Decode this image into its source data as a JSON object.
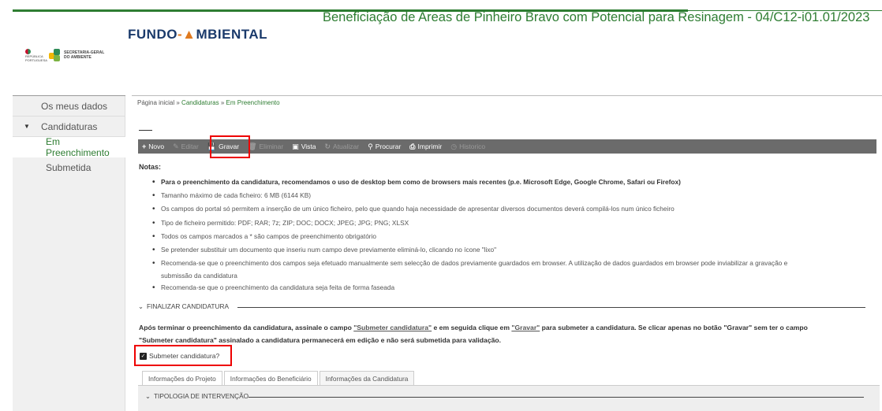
{
  "header": {
    "page_title": "Beneficiação de Areas de Pinheiro Bravo com Potencial para Resinagem - 04/C12-i01.01/2023",
    "fundo_logo": {
      "part1": "FUNDO",
      "part2": "MBIENTAL"
    },
    "rep_logo": "REPÚBLICA PORTUGUESA",
    "sg_logo": {
      "line1": "SECRETARIA-GERAL",
      "line2": "DO AMBIENTE"
    }
  },
  "sidebar": {
    "items": [
      {
        "label": "Os meus dados"
      },
      {
        "label": "Candidaturas",
        "expanded": true
      },
      {
        "label": "Em Preenchimento",
        "active": true
      },
      {
        "label": "Submetida"
      }
    ]
  },
  "breadcrumb": {
    "home": "Página inicial",
    "sep": " » ",
    "level1": "Candidaturas",
    "level2": "Em Preenchimento"
  },
  "toolbar": {
    "buttons": [
      {
        "label": "Novo",
        "icon": "plus-icon",
        "enabled": true
      },
      {
        "label": "Editar",
        "icon": "pencil-icon",
        "enabled": false
      },
      {
        "label": "Gravar",
        "icon": "save-icon",
        "enabled": true
      },
      {
        "label": "Eliminar",
        "icon": "trash-icon",
        "enabled": false
      },
      {
        "label": "Vista",
        "icon": "view-icon",
        "enabled": true
      },
      {
        "label": "Atualizar",
        "icon": "refresh-icon",
        "enabled": false
      },
      {
        "label": "Procurar",
        "icon": "search-icon",
        "enabled": true
      },
      {
        "label": "Imprimir",
        "icon": "print-icon",
        "enabled": true
      },
      {
        "label": "Historico",
        "icon": "history-icon",
        "enabled": false
      }
    ]
  },
  "notes": {
    "title": "Notas:",
    "items": [
      "Para o preenchimento da candidatura, recomendamos o uso de desktop bem como de browsers mais recentes (p.e. Microsoft Edge, Google Chrome, Safari ou Firefox)",
      "Tamanho máximo de cada ficheiro: 6 MB (6144 KB)",
      "Os campos do portal só permitem a inserção de um único ficheiro, pelo que quando haja necessidade de apresentar diversos documentos deverá compilá-los num único ficheiro",
      "Tipo de ficheiro permitido: PDF; RAR; 7z; ZIP; DOC; DOCX; JPEG; JPG; PNG; XLSX",
      "Todos os campos marcados a * são campos de preenchimento obrigatório",
      "Se pretender substituir um documento que inseriu num campo deve previamente eliminá-lo, clicando no ícone \"lixo\"",
      "Recomenda-se que o preenchimento dos campos seja efetuado manualmente sem selecção de dados previamente guardados em browser. A utilização de dados guardados em browser pode inviabilizar a gravação e",
      "submissão da candidatura",
      "Recomenda-se que o preenchimento da candidatura seja feita de forma faseada"
    ]
  },
  "finalizar": {
    "legend": "FINALIZAR CANDIDATURA",
    "text1": "Após terminar o preenchimento da candidatura, assinale o campo ",
    "link1": "\"Submeter candidatura\"",
    "text2": " e em seguida clique em ",
    "link2": "\"Gravar\"",
    "text3": " para submeter a candidatura. Se clicar apenas no botão \"Gravar\" sem ter o campo",
    "text4": "\"Submeter candidatura\" assinalado a candidatura permanecerá em edição e não será submetida para validação.",
    "checkbox_label": "Submeter candidatura?",
    "checkbox_checked": true
  },
  "tabs": [
    {
      "label": "Informações do Projeto"
    },
    {
      "label": "Informações do Beneficiário"
    },
    {
      "label": "Informações da Candidatura",
      "active": true
    }
  ],
  "tipologia": {
    "legend": "TIPOLOGIA DE INTERVENÇÃO"
  },
  "colors": {
    "brand_green": "#2e7d32",
    "toolbar_bg": "#6b6b6b",
    "highlight": "#e00000"
  }
}
